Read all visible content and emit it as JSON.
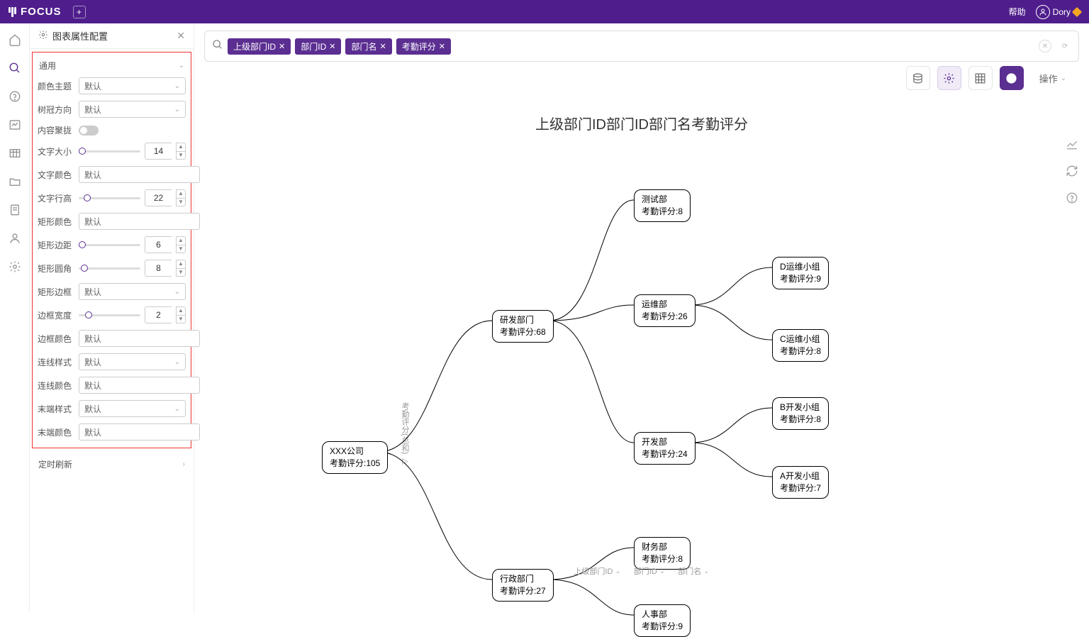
{
  "header": {
    "logo": "FOCUS",
    "help": "帮助",
    "user": "Dory"
  },
  "panel": {
    "title": "图表属性配置",
    "section": "通用",
    "timer": "定时刷新"
  },
  "labels": {
    "colorTheme": "颜色主题",
    "treeDir": "树冠方向",
    "contentFocus": "内容聚拢",
    "fontSize": "文字大小",
    "fontColor": "文字颜色",
    "lineHeight": "文字行高",
    "rectColor": "矩形颜色",
    "rectMargin": "矩形边距",
    "rectRadius": "矩形圆角",
    "rectBorder": "矩形边框",
    "borderWidth": "边框宽度",
    "borderColor": "边框颜色",
    "lineStyle": "连线样式",
    "lineColor": "连线颜色",
    "endStyle": "末端样式",
    "endColor": "末端颜色"
  },
  "values": {
    "default": "默认",
    "fontSize": "14",
    "lineHeight": "22",
    "rectMargin": "6",
    "rectRadius": "8",
    "borderWidth": "2"
  },
  "search": {
    "tags": [
      "上级部门ID",
      "部门ID",
      "部门名",
      "考勤评分"
    ]
  },
  "toolbar": {
    "operate": "操作"
  },
  "chart": {
    "title": "上级部门ID部门ID部门名考勤评分",
    "vertLabel": "考勤评分(总和) ▷",
    "axis": [
      "上级部门ID",
      "部门ID",
      "部门名"
    ]
  },
  "nodes": {
    "root": {
      "l1": "XXX公司",
      "l2": "考勤评分:105"
    },
    "rd": {
      "l1": "研发部门",
      "l2": "考勤评分:68"
    },
    "admin": {
      "l1": "行政部门",
      "l2": "考勤评分:27"
    },
    "test": {
      "l1": "测试部",
      "l2": "考勤评分:8"
    },
    "ops": {
      "l1": "运维部",
      "l2": "考勤评分:26"
    },
    "dev": {
      "l1": "开发部",
      "l2": "考勤评分:24"
    },
    "fin": {
      "l1": "财务部",
      "l2": "考勤评分:8"
    },
    "hr": {
      "l1": "人事部",
      "l2": "考勤评分:9"
    },
    "dops": {
      "l1": "D运维小组",
      "l2": "考勤评分:9"
    },
    "cops": {
      "l1": "C运维小组",
      "l2": "考勤评分:8"
    },
    "bdev": {
      "l1": "B开发小组",
      "l2": "考勤评分:8"
    },
    "adev": {
      "l1": "A开发小组",
      "l2": "考勤评分:7"
    }
  },
  "chart_data": {
    "type": "tree",
    "title": "上级部门ID部门ID部门名考勤评分",
    "value_label": "考勤评分",
    "root": {
      "name": "XXX公司",
      "value": 105,
      "children": [
        {
          "name": "研发部门",
          "value": 68,
          "children": [
            {
              "name": "测试部",
              "value": 8
            },
            {
              "name": "运维部",
              "value": 26,
              "children": [
                {
                  "name": "D运维小组",
                  "value": 9
                },
                {
                  "name": "C运维小组",
                  "value": 8
                }
              ]
            },
            {
              "name": "开发部",
              "value": 24,
              "children": [
                {
                  "name": "B开发小组",
                  "value": 8
                },
                {
                  "name": "A开发小组",
                  "value": 7
                }
              ]
            }
          ]
        },
        {
          "name": "行政部门",
          "value": 27,
          "children": [
            {
              "name": "财务部",
              "value": 8
            },
            {
              "name": "人事部",
              "value": 9
            }
          ]
        }
      ]
    }
  }
}
